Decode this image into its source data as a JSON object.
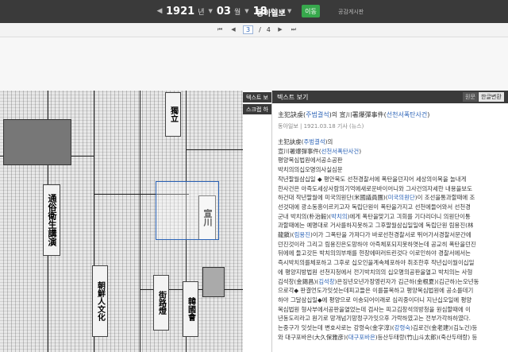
{
  "topbar": {
    "year": "1921",
    "year_unit": "년",
    "month": "03",
    "month_unit": "월",
    "day": "18",
    "day_unit": "일",
    "newspaper": "동아일보",
    "go_label": "이동",
    "link_label": "공감게시판"
  },
  "pager": {
    "current": "3",
    "separator": "/",
    "total": "4"
  },
  "sidetabs": [
    "텍스트 보",
    "스크랩 하"
  ],
  "panel": {
    "title": "텍스트 보기",
    "original_label": "원문",
    "modern_label": "한글변환",
    "article_title": {
      "part1": "主犯訣虔(",
      "part1_blue": "주범결석",
      "part2": ")의 宣川署爆彈事件(",
      "part2_blue": "선천서폭탄사건",
      "part3": ")"
    },
    "meta": "동아일보 | 1921.03.18 기사 (뉴스)",
    "body_lines": [
      {
        "t": "主犯訣虔(",
        "b": "주범결석",
        "a": ")의"
      },
      {
        "t": "宣川署爆彈事件(",
        "b": "선천서폭탄사건",
        "a": ")"
      },
      {
        "t": "평양복심법원에서공소공판",
        "b": "",
        "a": ""
      },
      {
        "t": "박치의의십오명의사실심문",
        "b": "",
        "a": ""
      },
      {
        "t": "작년팔월삼십일 ◆ 평안북도 선천경찰서에 폭탄을던지어 세상의이목을 놀내게",
        "b": "",
        "a": ""
      },
      {
        "t": "한사건은 아즉도세상사람의기억에새로운바이어니와 그사건의자세한 내용을보도",
        "b": "",
        "a": ""
      },
      {
        "t": "하건대 작년팔월에 미국의원단(米國議員團)(",
        "b": "미국의원단",
        "a": ")이 조선을통과할때에 조"
      },
      {
        "t": "선것대에 광소동흥이르키고자 독립단원이 폭탄을가지고 선천에들어와서 선천경",
        "b": "",
        "a": ""
      },
      {
        "t": "군내 박치의(朴治毅)(",
        "b": "박치의",
        "a": ")에게 폭탄을맞기고 긔회를 기다리더니 의원단이통"
      },
      {
        "t": "과할때에는 예명대로 거사를하지못하고 그후팔월삼십일일에 독립단원 림용진(林",
        "b": "",
        "a": ""
      },
      {
        "t": "龍鎭)(",
        "b": "림용진",
        "a": ")이가 그폭탄을 가져다가 바로선천경찰서로 뛰어가서경찰서문간에"
      },
      {
        "t": "던진것이라 그리고 림용진은도망하야 아즉체포되지못하엿는데 공교히 폭탄을던진",
        "b": "",
        "a": ""
      },
      {
        "t": "뒤에에 들고갓든 박치의의부채를 현장에떠러트린것다 이로인하야 경찰서에서는",
        "b": "",
        "a": ""
      },
      {
        "t": "즉시박치의를체포하고 그후로 십오인을계속체포하야 취조한후 작년십이월이십일",
        "b": "",
        "a": ""
      },
      {
        "t": "에 평양지방법원 선천지청에서 전기박치의의 십오명의공판을열고 박치의는 사형",
        "b": "",
        "a": ""
      },
      {
        "t": "김석창(金錫昌)(",
        "b": "김석창",
        "a": ")은징년오년가장영린자가 김근하(金根夏)(김근하)는오년동"
      },
      {
        "t": "으로각◆ 판결언도가잇섯는데피고들은 이를불복하고 평양복심법원에 공소를데기",
        "b": "",
        "a": ""
      },
      {
        "t": "하야 그달삼십일◆에 평양으로 이송되어이래로 심리중이더니 지난십오일에 평양",
        "b": "",
        "a": ""
      },
      {
        "t": "복심법원 형사부에서공판을열었는데 검사는 피고김창석의방청을 원심할때에 이",
        "b": "",
        "a": ""
      },
      {
        "t": "년동도리라고 원기로 망개넘기망정구가잇으후 가락하였고는 전부가각하하였다.",
        "b": "",
        "a": ""
      },
      {
        "t": "는중구가 잇섯는데 변호사로는 강령숙(金字淳)(",
        "b": "강령숙",
        "a": ")김로건(金老建)(김노건)등"
      },
      {
        "t": "와 대구포바은(大久保雅彦)(",
        "b": "대구포바은",
        "a": ")등산두태랑(竹山斗太郎)(죽산두태랑) 등"
      }
    ]
  }
}
